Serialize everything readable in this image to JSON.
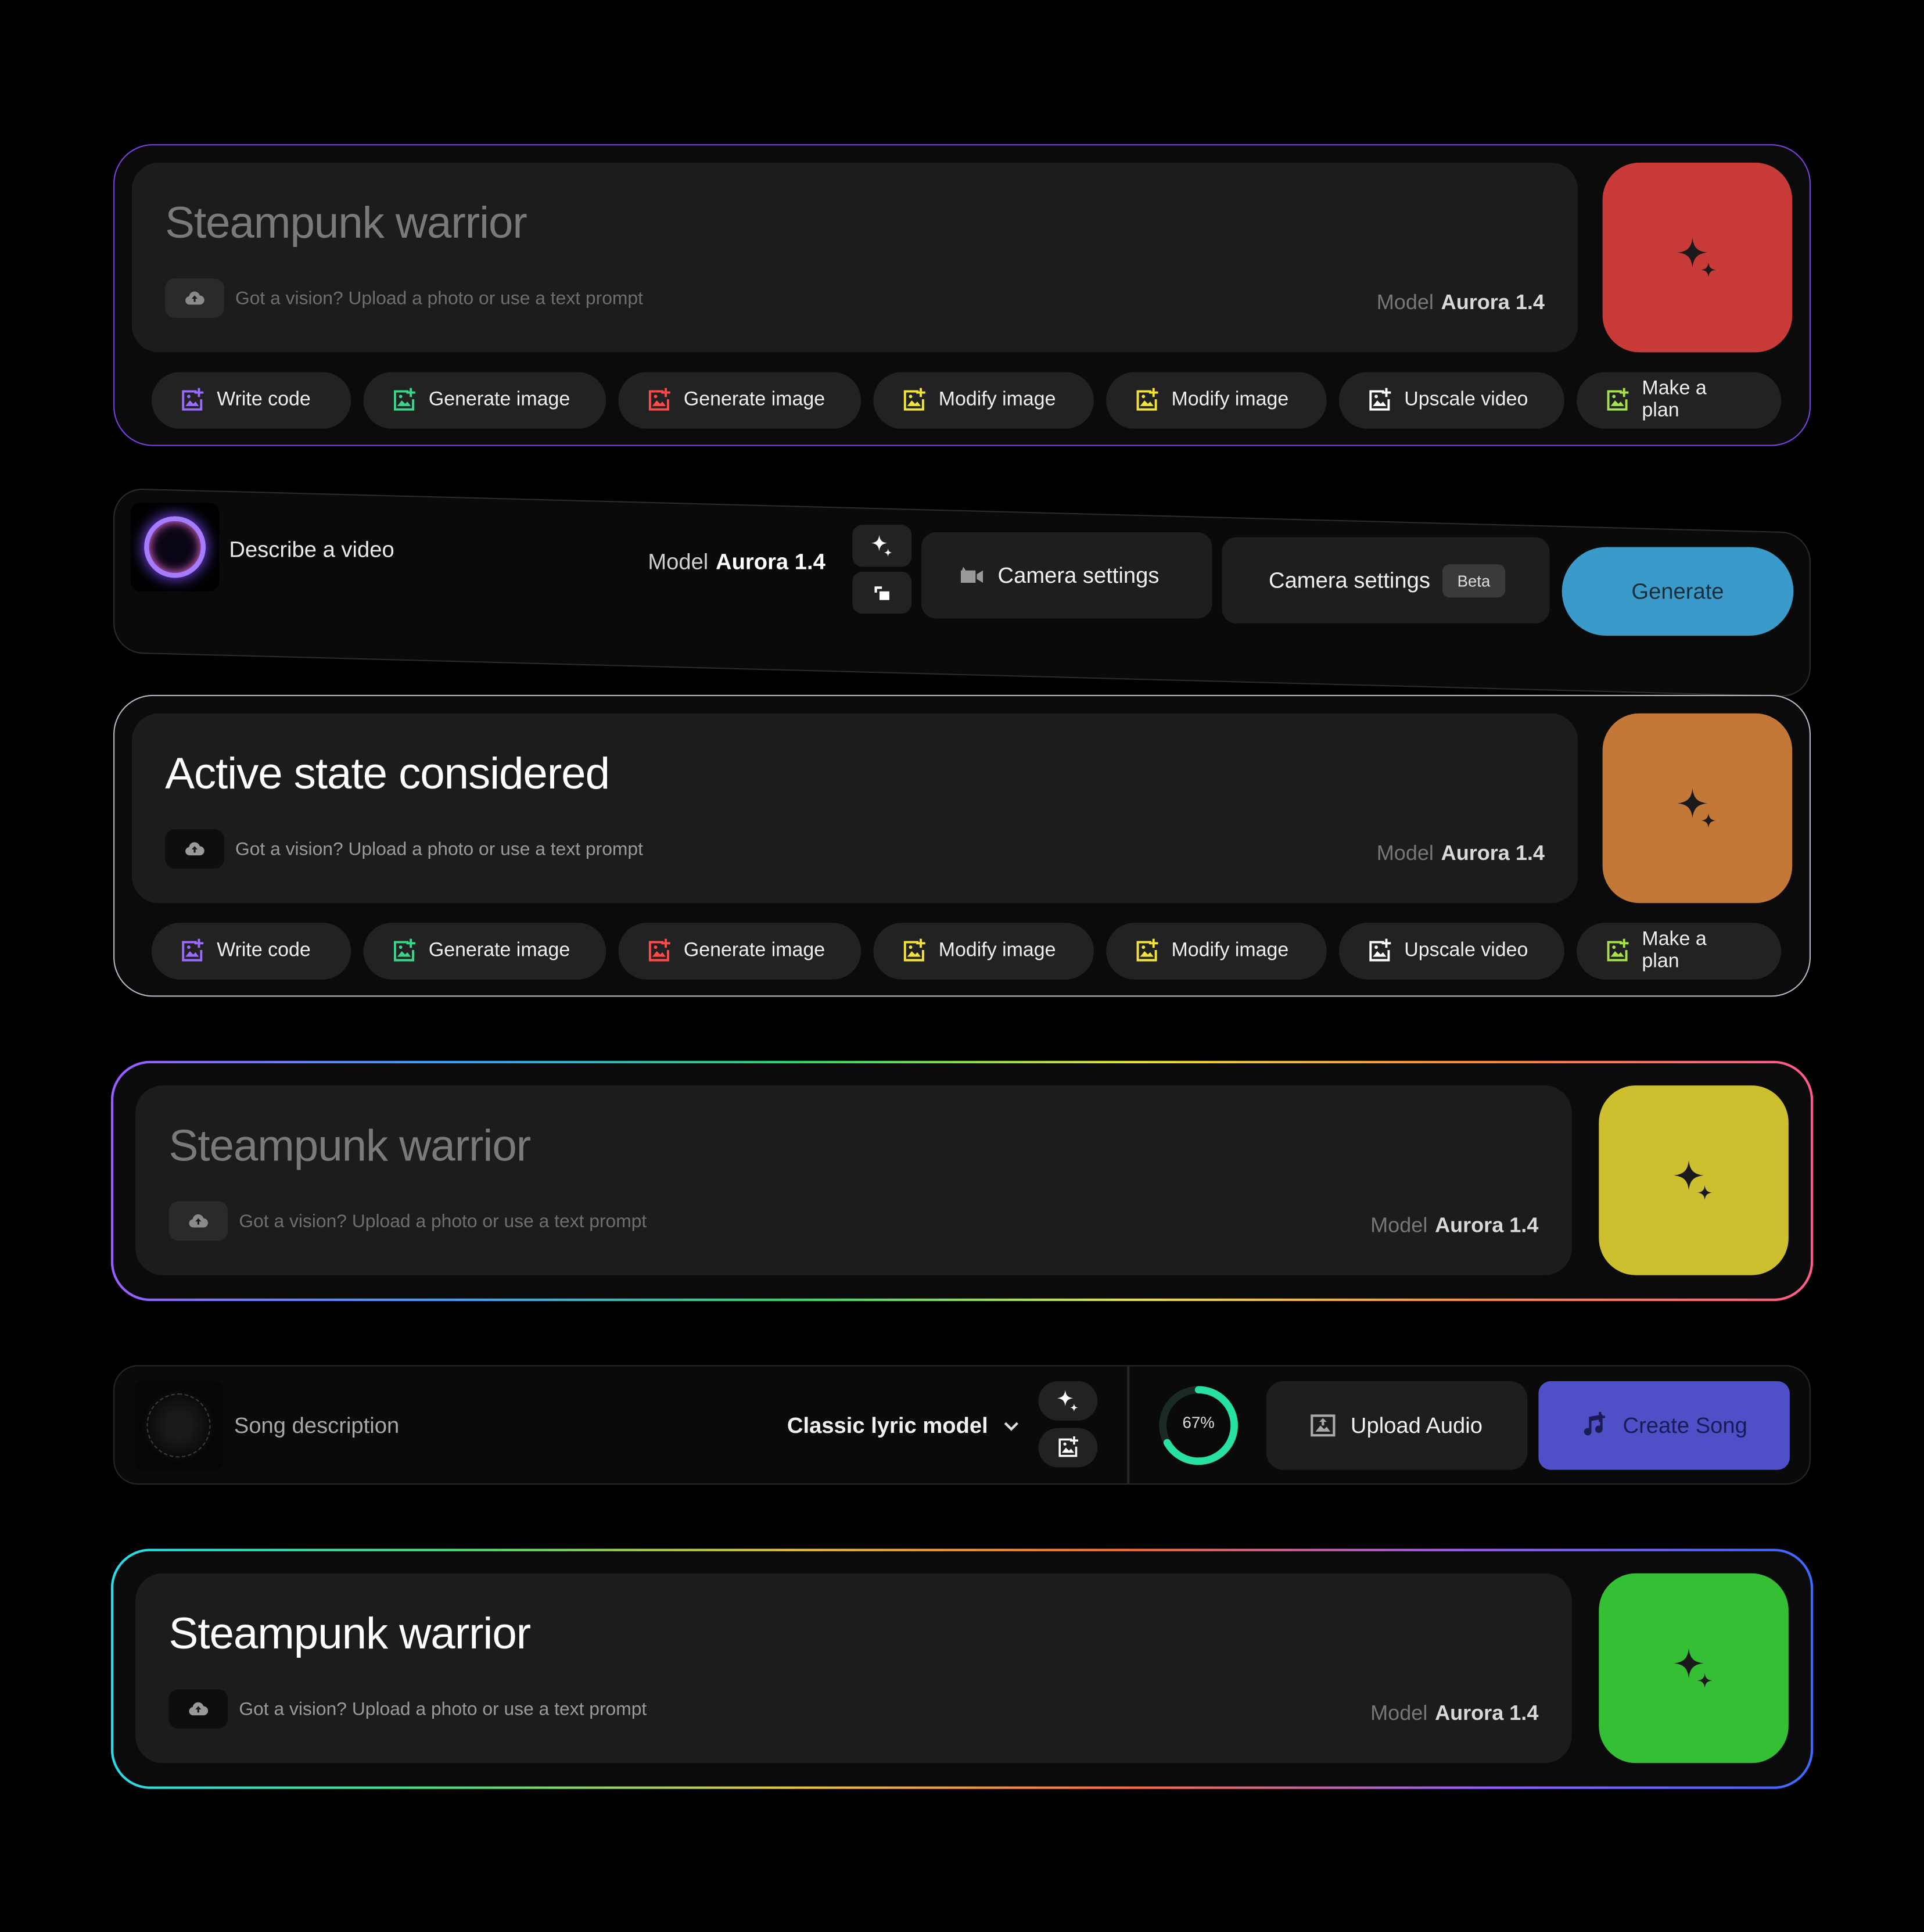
{
  "model": {
    "label": "Model",
    "name": "Aurora 1.4"
  },
  "upload_hint": "Got a vision? Upload a photo or use a text prompt",
  "colors": {
    "generate_red": "#c83b38",
    "generate_orange": "#c47838",
    "generate_yellow": "#cdbf2e",
    "generate_green": "#35bf35",
    "video_generate": "#3a9bcb",
    "create_song": "#4f4fc7",
    "progress_ring": "#27e0a3"
  },
  "cards": [
    {
      "title": "Steampunk warrior",
      "state": "idle"
    },
    {
      "title": "Active state considered",
      "state": "active"
    },
    {
      "title": "Steampunk warrior",
      "state": "idle"
    },
    {
      "title": "Steampunk warrior",
      "state": "active"
    }
  ],
  "quick_actions": [
    {
      "label": "Write code",
      "icon": "image-plus-icon",
      "color": "#9b6bff"
    },
    {
      "label": "Generate image",
      "icon": "image-plus-icon",
      "color": "#3ad48a"
    },
    {
      "label": "Generate image",
      "icon": "image-plus-icon",
      "color": "#ff4a4a"
    },
    {
      "label": "Modify image",
      "icon": "image-plus-icon",
      "color": "#f2e33a"
    },
    {
      "label": "Modify image",
      "icon": "image-plus-icon",
      "color": "#f2e33a"
    },
    {
      "label": "Upscale video",
      "icon": "image-plus-icon",
      "color": "#ffffff"
    },
    {
      "label": "Make a plan",
      "icon": "image-plus-icon",
      "color": "#a6e04a"
    }
  ],
  "video_bar": {
    "placeholder": "Describe a video",
    "camera_settings": "Camera settings",
    "camera_settings_beta": "Camera settings",
    "beta_badge": "Beta",
    "generate": "Generate"
  },
  "song_bar": {
    "placeholder": "Song description",
    "model": "Classic lyric model",
    "progress_percent": 67,
    "progress_label": "67%",
    "upload_audio": "Upload Audio",
    "create_song": "Create Song"
  }
}
